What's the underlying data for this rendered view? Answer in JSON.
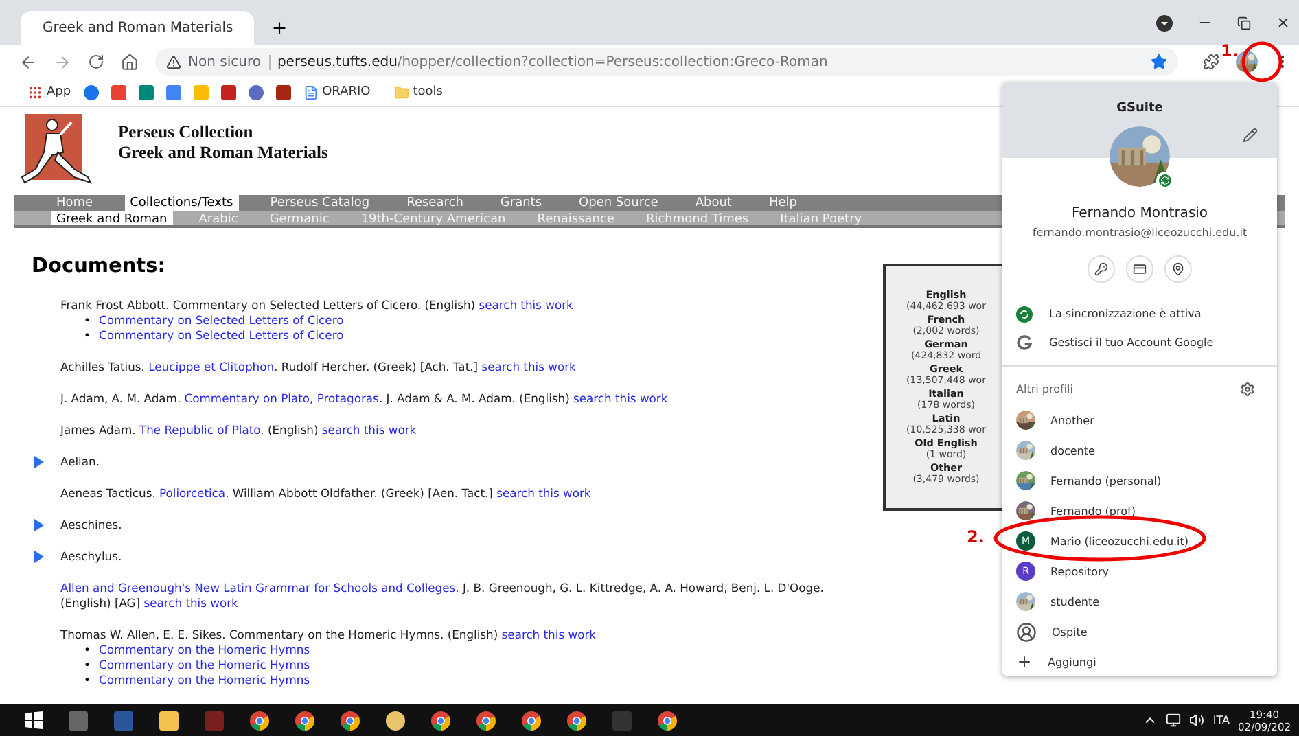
{
  "browser": {
    "tab_title": "Greek and Roman Materials",
    "security": "Non sicuro",
    "domain": "perseus.tufts.edu",
    "path": "/hopper/collection?collection=Perseus:collection:Greco-Roman",
    "bookmarks": {
      "apps": "App",
      "orario": "ORARIO",
      "tools": "tools"
    }
  },
  "site": {
    "title_lines": [
      "Perseus Collection",
      "Greek and Roman Materials"
    ],
    "nav": [
      {
        "label": "Home",
        "selected": false
      },
      {
        "label": "Collections/Texts",
        "selected": true
      },
      {
        "label": "Perseus Catalog",
        "selected": false
      },
      {
        "label": "Research",
        "selected": false
      },
      {
        "label": "Grants",
        "selected": false
      },
      {
        "label": "Open Source",
        "selected": false
      },
      {
        "label": "About",
        "selected": false
      },
      {
        "label": "Help",
        "selected": false
      }
    ],
    "subnav": [
      {
        "label": "Greek and Roman",
        "selected": true
      },
      {
        "label": "Arabic",
        "selected": false
      },
      {
        "label": "Germanic",
        "selected": false
      },
      {
        "label": "19th-Century American",
        "selected": false
      },
      {
        "label": "Renaissance",
        "selected": false
      },
      {
        "label": "Richmond Times",
        "selected": false
      },
      {
        "label": "Italian Poetry",
        "selected": false
      }
    ]
  },
  "documents": {
    "heading": "Documents:",
    "bullet": "•",
    "entries": [
      {
        "expandable": false,
        "segments": [
          {
            "text": "Frank Frost Abbott. Commentary on Selected Letters of Cicero. (English) ",
            "link": false
          },
          {
            "text": "search this work",
            "link": true
          }
        ],
        "sublinks": [
          "Commentary on Selected Letters of Cicero",
          "Commentary on Selected Letters of Cicero"
        ]
      },
      {
        "expandable": false,
        "segments": [
          {
            "text": "Achilles Tatius. ",
            "link": false
          },
          {
            "text": "Leucippe et Clitophon",
            "link": true
          },
          {
            "text": ". Rudolf Hercher. (Greek) [Ach. Tat.] ",
            "link": false
          },
          {
            "text": "search this work",
            "link": true
          }
        ]
      },
      {
        "expandable": false,
        "segments": [
          {
            "text": "J. Adam, A. M. Adam. ",
            "link": false
          },
          {
            "text": "Commentary on Plato, Protagoras",
            "link": true
          },
          {
            "text": ". J. Adam & A. M. Adam. (English) ",
            "link": false
          },
          {
            "text": "search this work",
            "link": true
          }
        ]
      },
      {
        "expandable": false,
        "segments": [
          {
            "text": "James Adam. ",
            "link": false
          },
          {
            "text": "The Republic of Plato",
            "link": true
          },
          {
            "text": ". (English) ",
            "link": false
          },
          {
            "text": "search this work",
            "link": true
          }
        ]
      },
      {
        "expandable": true,
        "segments": [
          {
            "text": "Aelian.",
            "link": false
          }
        ]
      },
      {
        "expandable": false,
        "segments": [
          {
            "text": "Aeneas Tacticus. ",
            "link": false
          },
          {
            "text": "Poliorcetica",
            "link": true
          },
          {
            "text": ". William Abbott Oldfather. (Greek) [Aen. Tact.] ",
            "link": false
          },
          {
            "text": "search this work",
            "link": true
          }
        ]
      },
      {
        "expandable": true,
        "segments": [
          {
            "text": "Aeschines.",
            "link": false
          }
        ]
      },
      {
        "expandable": true,
        "segments": [
          {
            "text": "Aeschylus.",
            "link": false
          }
        ]
      },
      {
        "expandable": false,
        "segments": [
          {
            "text": "Allen and Greenough's New Latin Grammar for Schools and Colleges",
            "link": true
          },
          {
            "text": ". J. B. Greenough, G. L. Kittredge, A. A. Howard, Benj. L. D'Ooge. (English) [AG] ",
            "link": false
          },
          {
            "text": "search this work",
            "link": true
          }
        ]
      },
      {
        "expandable": false,
        "segments": [
          {
            "text": "Thomas W. Allen, E. E. Sikes. Commentary on the Homeric Hymns. (English) ",
            "link": false
          },
          {
            "text": "search this work",
            "link": true
          }
        ],
        "sublinks": [
          "Commentary on the Homeric Hymns",
          "Commentary on the Homeric Hymns",
          "Commentary on the Homeric Hymns"
        ]
      }
    ]
  },
  "stats": [
    {
      "language": "English",
      "count": "(44,462,693 wor"
    },
    {
      "language": "French",
      "count": "(2,002 words)"
    },
    {
      "language": "German",
      "count": "(424,832 word"
    },
    {
      "language": "Greek",
      "count": "(13,507,448 wor"
    },
    {
      "language": "Italian",
      "count": "(178 words)"
    },
    {
      "language": "Latin",
      "count": "(10,525,338 wor"
    },
    {
      "language": "Old English",
      "count": "(1 word)"
    },
    {
      "language": "Other",
      "count": "(3,479 words)"
    }
  ],
  "profile_menu": {
    "title": "GSuite",
    "name": "Fernando Montrasio",
    "email": "fernando.montrasio@liceozucchi.edu.it",
    "sync": "La sincronizzazione è attiva",
    "manage": "Gestisci il tuo Account Google",
    "others_label": "Altri profili",
    "profiles": [
      {
        "name": "Another"
      },
      {
        "name": "docente"
      },
      {
        "name": "Fernando (personal)"
      },
      {
        "name": "Fernando (prof)"
      },
      {
        "kind": "letter",
        "letter": "M",
        "color": "#0d5c3d",
        "name": "Mario (liceozucchi.edu.it)"
      },
      {
        "kind": "letter",
        "letter": "R",
        "color": "#5b3cc4",
        "name": "Repository"
      },
      {
        "name": "studente"
      },
      {
        "kind": "guest",
        "name": "Ospite"
      }
    ],
    "add": "Aggiungi"
  },
  "annotations": [
    "1.",
    "2."
  ],
  "taskbar": {
    "language": "ITA",
    "time": "19:40",
    "date": "02/09/202"
  }
}
